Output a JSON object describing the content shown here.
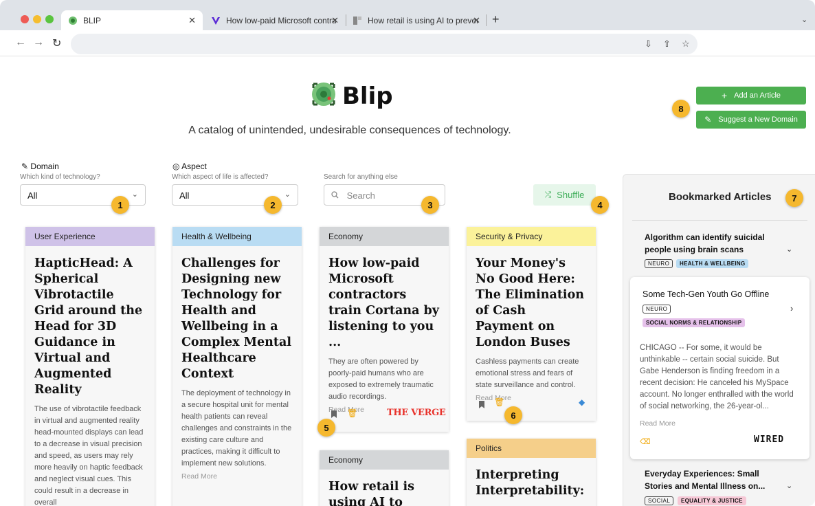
{
  "browser": {
    "tabs": [
      {
        "title": "BLIP"
      },
      {
        "title": "How low-paid Microsoft contra"
      },
      {
        "title": "How retail is using AI to preven"
      }
    ]
  },
  "header": {
    "logo_text": "Blip",
    "tagline": "A catalog of unintended, undesirable consequences of technology.",
    "add_article": "Add an Article",
    "suggest_domain": "Suggest a New Domain"
  },
  "filters": {
    "domain_label": "Domain",
    "domain_hint": "Which kind of technology?",
    "domain_value": "All",
    "aspect_label": "Aspect",
    "aspect_hint": "Which aspect of life is affected?",
    "aspect_value": "All",
    "search_hint": "Search for anything else",
    "search_placeholder": "Search",
    "shuffle": "Shuffle"
  },
  "badges": [
    "1",
    "2",
    "3",
    "4",
    "5",
    "6",
    "7",
    "8"
  ],
  "cards": [
    {
      "category": "User Experience",
      "title": "HapticHead: A Spherical Vibrotactile Grid around the Head for 3D Guidance in Virtual and Augmented Reality",
      "desc": "The use of vibrotactile feedback in virtual and augmented reality head-mounted displays can lead to a decrease in visual precision and speed, as users may rely more heavily on haptic feedback and neglect visual cues. This could result in a decrease in overall"
    },
    {
      "category": "Health & Wellbeing",
      "title": "Challenges for Designing new Technology for Health and Wellbeing in a Complex Mental Healthcare Context",
      "desc": "The deployment of technology in a secure hospital unit for mental health patients can reveal challenges and constraints in the existing care culture and practices, making it difficult to implement new solutions.",
      "more": "Read More"
    },
    {
      "category": "Economy",
      "title": "How low-paid Microsoft contractors train Cortana by listening to you ...",
      "desc": "They are often powered by poorly-paid humans who are exposed to extremely traumatic audio recordings.",
      "more": "Read More",
      "source": "THE VERGE"
    },
    {
      "category": "Economy",
      "title": "How retail is using AI to prevent"
    },
    {
      "category": "Security & Privacy",
      "title": "Your Money's No Good Here: The Elimination of Cash Payment on London Buses",
      "desc": "Cashless payments can create emotional stress and fears of state surveillance and control.",
      "more": "Read More"
    },
    {
      "category": "Politics",
      "title": "Interpreting Interpretability:"
    }
  ],
  "bookmarks": {
    "title": "Bookmarked Articles",
    "items": [
      {
        "title": "Algorithm can identify suicidal people using brain scans",
        "tags": [
          "NEURO",
          "HEALTH & WELLBEING"
        ]
      },
      {
        "title": "Some Tech-Gen Youth Go Offline",
        "tags": [
          "NEURO",
          "SOCIAL NORMS & RELATIONSHIP"
        ],
        "body": "CHICAGO -- For some, it would be unthinkable -- certain social suicide. But Gabe Henderson is finding freedom in a recent decision: He canceled his MySpace account. No longer enthralled with the world of social networking, the 26-year-ol...",
        "more": "Read More",
        "source": "WIRED"
      },
      {
        "title": "Everyday Experiences: Small Stories and Mental Illness on...",
        "tags": [
          "SOCIAL",
          "EQUALITY & JUSTICE"
        ]
      }
    ]
  },
  "colors": {
    "accent_green": "#4caf50",
    "badge": "#f5b82e"
  }
}
